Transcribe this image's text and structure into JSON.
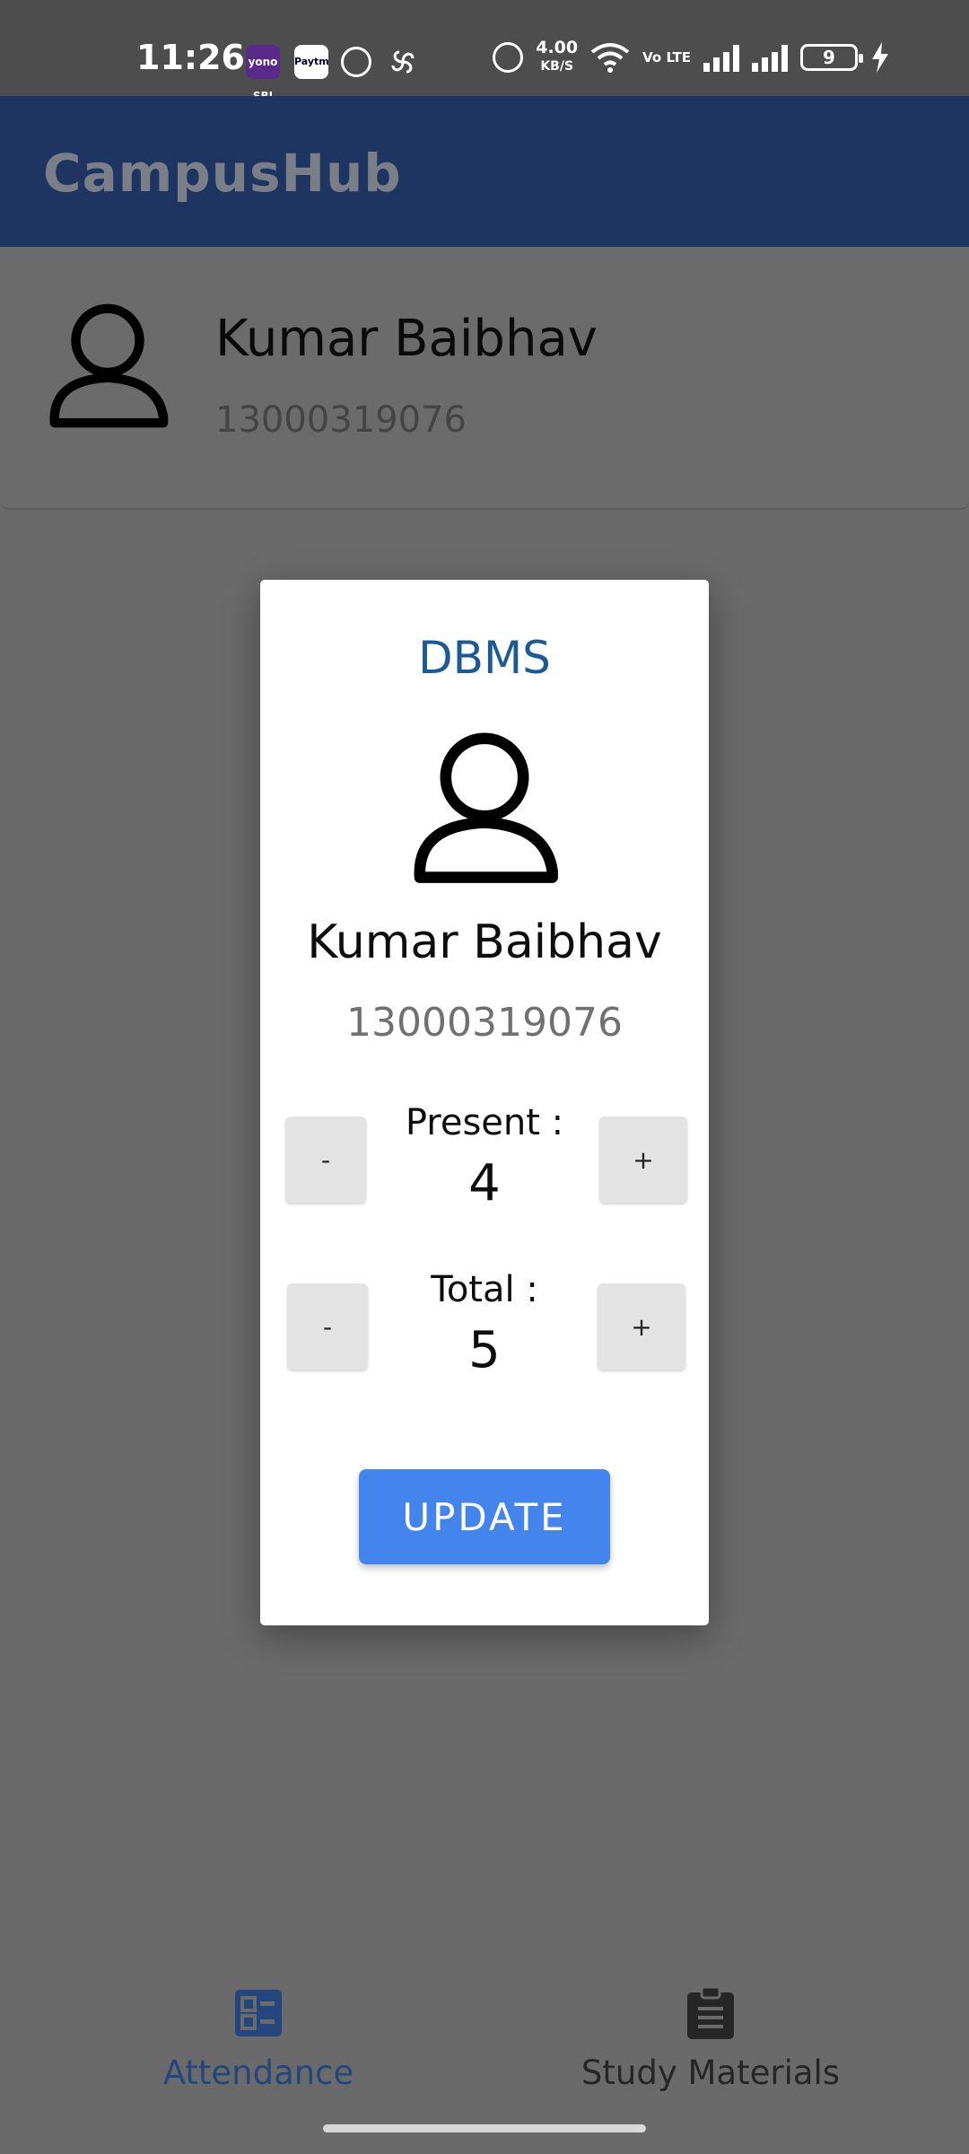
{
  "status_bar": {
    "time": "11:26",
    "notifications": [
      "yono",
      "Paytm",
      "check-circle",
      "pinwheel"
    ],
    "yono_label": "yono SBI",
    "paytm_label": "Paytm",
    "speed_value": "4.00",
    "speed_unit": "KB/S",
    "volte": "Vo LTE",
    "battery": "9"
  },
  "app": {
    "title": "CampusHub"
  },
  "profile": {
    "name": "Kumar Baibhav",
    "roll": "13000319076"
  },
  "dialog": {
    "subject": "DBMS",
    "name": "Kumar Baibhav",
    "roll": "13000319076",
    "present": {
      "label": "Present :",
      "value": "4",
      "minus": "-",
      "plus": "+"
    },
    "total": {
      "label": "Total :",
      "value": "5",
      "minus": "-",
      "plus": "+"
    },
    "update_label": "UPDATE"
  },
  "nav": {
    "items": [
      {
        "label": "Attendance",
        "icon": "attendance-icon",
        "active": true
      },
      {
        "label": "Study Materials",
        "icon": "clipboard-icon",
        "active": false
      }
    ]
  },
  "colors": {
    "app_bar": "#1e3561",
    "accent": "#4485ed",
    "subject": "#1c5a95",
    "active_nav": "#23467f"
  }
}
